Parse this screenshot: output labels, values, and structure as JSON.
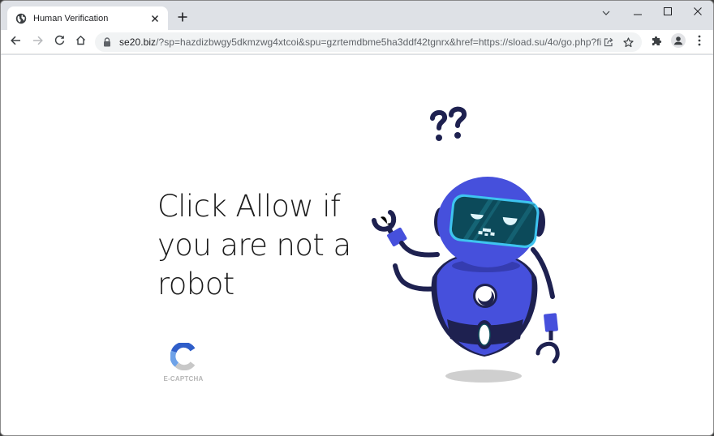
{
  "browser": {
    "tab": {
      "title": "Human Verification",
      "favicon": "globe-icon",
      "close_icon": "close-icon"
    },
    "new_tab_icon": "plus-icon",
    "window_controls": {
      "tab_search_icon": "chevron-down-icon",
      "minimize_icon": "minimize-icon",
      "maximize_icon": "maximize-icon",
      "close_icon": "close-icon"
    },
    "toolbar": {
      "back_icon": "arrow-left-icon",
      "forward_icon": "arrow-right-icon",
      "reload_icon": "reload-icon",
      "home_icon": "home-icon",
      "lock_icon": "lock-icon",
      "url_host": "se20.biz",
      "url_rest": "/?sp=hazdizbwgy5dkmzwg4xtcoi&spu=gzrtemdbme5ha3ddf42tgnrx&href=https://sload.su/4o/go.php?fil...",
      "share_icon": "share-icon",
      "bookmark_icon": "star-icon",
      "extensions_icon": "puzzle-icon",
      "profile_icon": "avatar-icon",
      "menu_icon": "kebab-menu-icon"
    }
  },
  "page": {
    "headline_lines": [
      "Click Allow if",
      "you are not a",
      "robot"
    ],
    "captcha": {
      "logo_icon": "captcha-c-icon",
      "label": "E-CAPTCHA"
    },
    "illustration": {
      "name": "confused-robot",
      "question_marks": "??",
      "colors": {
        "body": "#4650dc",
        "dark": "#1e2150",
        "visor": "#0c4a5a",
        "visor_rim": "#3ec4f0",
        "shadow": "#cfcfcf"
      }
    }
  },
  "colors": {
    "tabstrip": "#dee1e6",
    "omnibox": "#f1f3f4",
    "text": "#202124",
    "muted": "#5f6368",
    "captcha_dark": "#2f5ec9",
    "captcha_light": "#6ea2e8",
    "captcha_gray": "#c8c8c8"
  }
}
